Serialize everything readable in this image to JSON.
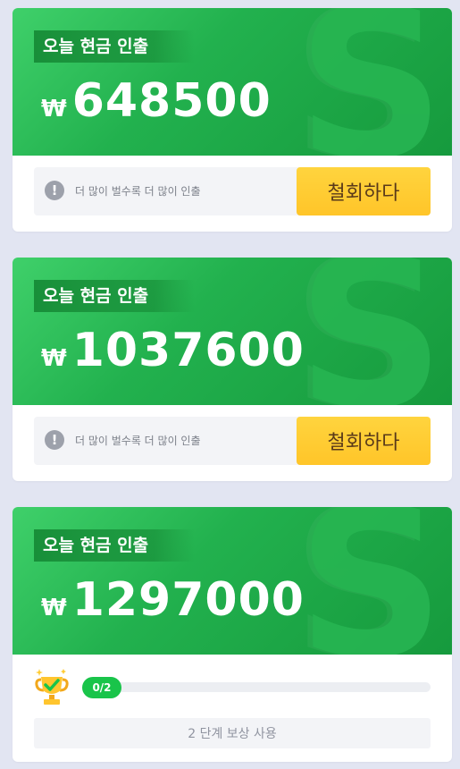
{
  "cards": [
    {
      "title": "오늘 현금 인출",
      "currency": "₩",
      "amount": "648500",
      "notice": "더 많이 벌수록 더 많이 인출",
      "button": "철회하다"
    },
    {
      "title": "오늘 현금 인출",
      "currency": "₩",
      "amount": "1037600",
      "notice": "더 많이 벌수록 더 많이 인출",
      "button": "철회하다"
    },
    {
      "title": "오늘 현금 인출",
      "currency": "₩",
      "amount": "1297000",
      "progress_label": "0/2",
      "progress": 0,
      "reward_button": "2 단계 보상 사용"
    }
  ],
  "icons": {
    "background_glyph": "dollar-s-icon",
    "warning": "exclamation-circle-icon",
    "trophy": "trophy-icon"
  },
  "colors": {
    "green": "#22b14e",
    "green_dark": "#169a3d",
    "yellow": "#ffc529",
    "progress_green": "#19c44a",
    "page_bg": "#e2e5f2"
  }
}
